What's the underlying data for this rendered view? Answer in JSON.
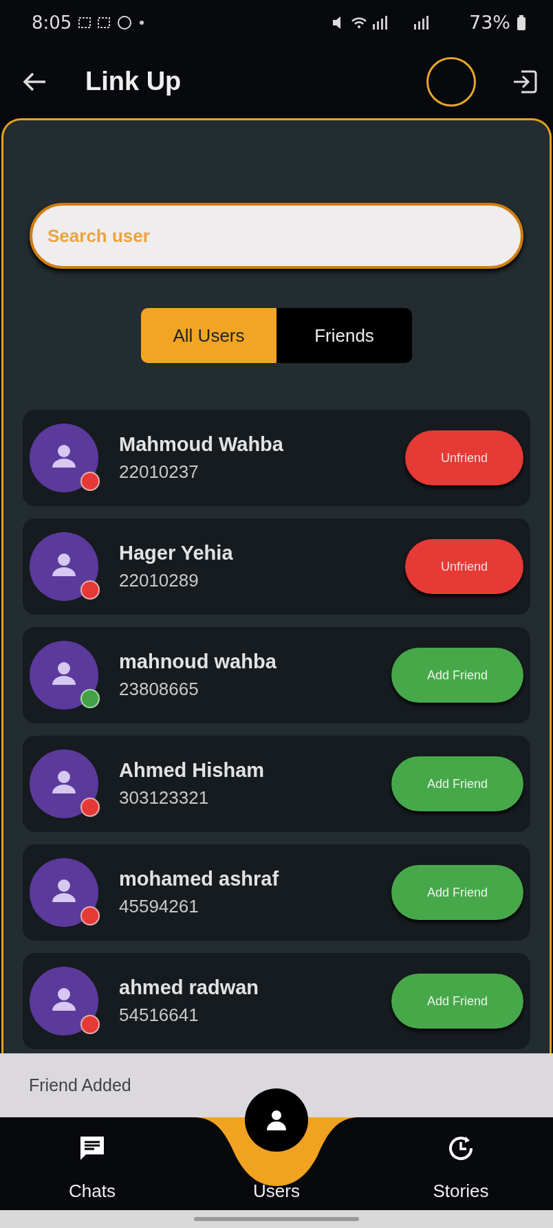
{
  "status_bar": {
    "time": "8:05",
    "battery": "73%"
  },
  "app_bar": {
    "title": "Link Up"
  },
  "search": {
    "placeholder": "Search user"
  },
  "tabs": [
    {
      "label": "All Users",
      "selected": true
    },
    {
      "label": "Friends",
      "selected": false
    }
  ],
  "users": [
    {
      "name": "Mahmoud Wahba",
      "id": "22010237",
      "online": false,
      "action": {
        "kind": "unfriend",
        "label": "Unfriend"
      }
    },
    {
      "name": "Hager Yehia",
      "id": "22010289",
      "online": false,
      "action": {
        "kind": "unfriend",
        "label": "Unfriend"
      }
    },
    {
      "name": "mahnoud wahba",
      "id": "23808665",
      "online": true,
      "action": {
        "kind": "add",
        "label": "Add Friend"
      }
    },
    {
      "name": "Ahmed Hisham",
      "id": "303123321",
      "online": false,
      "action": {
        "kind": "add",
        "label": "Add Friend"
      }
    },
    {
      "name": "mohamed ashraf",
      "id": "45594261",
      "online": false,
      "action": {
        "kind": "add",
        "label": "Add Friend"
      }
    },
    {
      "name": "ahmed radwan",
      "id": "54516641",
      "online": false,
      "action": {
        "kind": "add",
        "label": "Add Friend"
      }
    }
  ],
  "snackbar": {
    "message": "Friend Added"
  },
  "bottom_nav": [
    {
      "label": "Chats",
      "kind": "chat",
      "selected": false
    },
    {
      "label": "Users",
      "kind": "person",
      "selected": true
    },
    {
      "label": "Stories",
      "kind": "history",
      "selected": false
    }
  ]
}
